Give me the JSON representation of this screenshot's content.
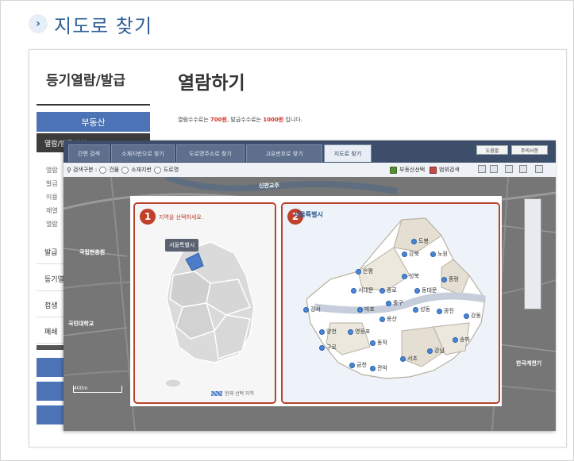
{
  "header": {
    "title": "지도로 찾기",
    "icon": "chevron-right-icon"
  },
  "sidebar": {
    "title": "등기열람/발급",
    "active_section": "부동산",
    "active_item": "열람/발급신청",
    "sub_items": [
      "열람",
      "발급",
      "이용",
      "재열",
      "열람"
    ],
    "menu_items": [
      "발급",
      "등기열",
      "접생",
      "폐쇄"
    ]
  },
  "main": {
    "title": "열람하기",
    "fee_prefix": "열람수수료는 ",
    "fee_view": "700원",
    "fee_mid": ", 발급수수료는 ",
    "fee_issue": "1000원",
    "fee_suffix": " 입니다."
  },
  "window": {
    "tabs": [
      "간편 검색",
      "소재지번으로 찾기",
      "도로명주소로 찾기",
      "고유번호로 찾기",
      "지도로 찾기"
    ],
    "right_buttons": [
      "도움말",
      "주의사항"
    ],
    "search_label": "검색구분 :",
    "search_options": [
      "건물",
      "소재지번",
      "도로명"
    ],
    "tool_labels": [
      "부동산선택",
      "범위검색"
    ],
    "map_labels": [
      "신판교주",
      "국립현충원",
      "국민대학교",
      "한국계천기"
    ],
    "scale": "400m",
    "modal": {
      "step1_hint": "지역을 선택하세요.",
      "step1_tooltip": "서울특별시",
      "legend": "현재 선택 지역",
      "step2_header": "서울특별시",
      "districts": [
        "도봉",
        "강북",
        "노원",
        "은평",
        "성북",
        "중랑",
        "종로",
        "동대문",
        "서대문",
        "중구",
        "강서",
        "마포",
        "성동",
        "광진",
        "용산",
        "양천",
        "영등포",
        "강동",
        "동작",
        "송파",
        "구로",
        "강남",
        "서초",
        "금천",
        "관악"
      ]
    }
  }
}
